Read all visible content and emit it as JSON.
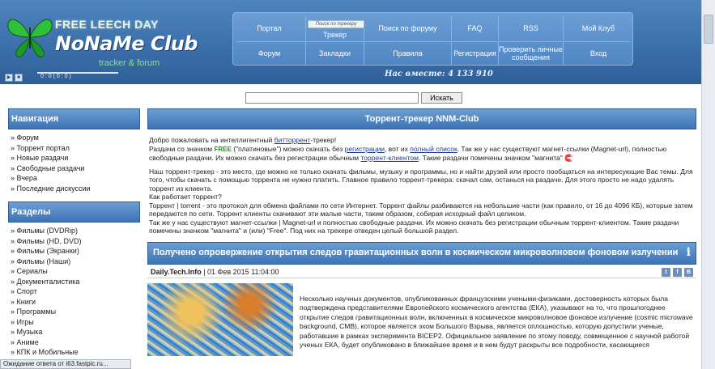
{
  "header": {
    "logo_top": "FREE LEECH DAY",
    "logo_name": "NoNaMe Club",
    "tagline": "tracker & forum",
    "player_time": "0 : 0     ( 0 : 0 )",
    "online": "Нас вместе: 4 133 910"
  },
  "nav": {
    "tracker_search_placeholder": "Поиск по трекеру",
    "row1": [
      "Портал",
      "Трекер",
      "Поиск по форуму",
      "FAQ",
      "RSS",
      "Мой Клуб"
    ],
    "row2": [
      "Форум",
      "Закладки",
      "Правила",
      "Регистрация",
      "Проверить личные сообщения",
      "Вход"
    ]
  },
  "search": {
    "button": "Искать",
    "value": ""
  },
  "sidebar": {
    "nav_title": "Навигация",
    "nav_items": [
      "» Форум",
      "» Торрент портал",
      "» Новые раздачи",
      "» Свободные раздачи",
      "» Вчера",
      "» Последние дискуссии"
    ],
    "sections_title": "Разделы",
    "sections": [
      "» Фильмы (DVDRip)",
      "» Фильмы (HD, DVD)",
      "» Фильмы (Экранки)",
      "» Фильмы (Наши)",
      "» Сериалы",
      "» Документалистика",
      "» Спорт",
      "» Книги",
      "» Программы",
      "» Игры",
      "» Музыка",
      "» Аниме",
      "» КПК и Мобильные"
    ]
  },
  "main": {
    "title": "Торрент-трекер NNM-Club",
    "welcome": {
      "l1_pre": "Добро пожаловать на интеллигентный ",
      "l1_link": "битторрент",
      "l1_post": "-трекер!",
      "l2_a": "Раздачи со значком ",
      "free_label": "FREE",
      "l2_b": " (\"платиновые\") можно скачать без ",
      "l2_link1": "регистрации",
      "l2_c": ", вот их ",
      "l2_link2": "полный список",
      "l2_d": ". Так же у нас существуют магнет-ссылки (Magnet-url), полностью свободные раздачи. Их можно скачать без регистрации обычным ",
      "l2_link3": "торрент-клиентом",
      "l2_e": ". Такие раздачи помечены значком \"магнита\"",
      "p2": "Наш торрент-трекер - это место, где можно не только скачать фильмы, музыку и программы, но и найти друзей или просто пообщаться на интересующие Вас темы. Для того, чтобы скачать с помощью торрента не нужно платить. Главное правило торрент-трекера: скачал сам, останься на раздаче. Для этого просто не надо удалять торрент из клиента.",
      "p3": "Как работает торрент?",
      "p4": "Торрент | torrent - это протокол для обмена файлами по сети Интернет. Торрент файлы разбиваются на небольшие части (как правило, от 16 до 4096 КБ), которые затем передаются по сети. Торрент клиенты скачивают эти малые части, таким образом, собирая исходный файл целиком.",
      "p5": "Так же у нас существуют магнет-ссылки | Magnet-url и полностью свободные раздачи. Их можно скачать без регистрации обычным торрент-клиентом. Такие раздачи помечены значком \"магнита\" и (или) \"Free\". Под них на трекере отведен целый большой раздел."
    },
    "news": {
      "title": "Получено опровержение открытия следов гравитационных волн в космическом микроволновом фоновом излучении",
      "source": "Daily.Tech.Info",
      "date": " | 01 Фев 2015 11:04:00",
      "body": "Несколько научных документов, опубликованных французскими учеными-физиками, достоверность которых была подтверждена представителями Европейского космического агентства (ЕКА), указывают на то, что прошлогоднее открытие следов гравитационных волн, включенных в космическое микроволновое фоновое излучение (cosmic microwave background, CMB), которое является эхом Большого Взрыва, является оплошностью, которую допустили ученые, работавшие в рамках эксперимента BICEP2. Официальное заявление по этому поводу, совмещенное с научной работой ученых ЕКА, будет опубликовано в ближайшее время и в нем будут раскрыты все подробности, касающиеся"
    }
  },
  "statusbar": "Ожидание ответа от i63.fastpic.ru..."
}
